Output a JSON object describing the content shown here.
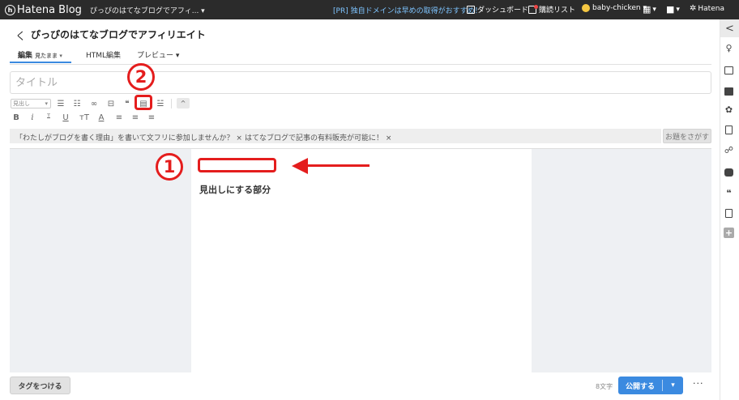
{
  "topbar": {
    "brand": "Hatena Blog",
    "brand_glyph": "h",
    "blog_select": "ぴっぴのはてなブログでアフィ... ▾",
    "pr_text": "[PR] 独自ドメインは早めの取得がおすすめ！",
    "dashboard": "ダッシュボード",
    "reading_list": "購読リスト",
    "user": "baby-chicken ▾",
    "grid_caret": "▾",
    "chat_caret": "▾",
    "hatena": "Hatena"
  },
  "header": {
    "back": "く",
    "blog_title": "ぴっぴのはてなブログでアフィリエイト"
  },
  "tabs": [
    {
      "label": "編集",
      "sub": "見たまま ▾"
    },
    {
      "label": "HTML編集"
    },
    {
      "label": "プレビュー ▾"
    }
  ],
  "title_input": {
    "placeholder": "タイトル"
  },
  "toolbar": {
    "heading_select": "見出し",
    "heading_caret": "▾",
    "row1": [
      "☰",
      "☷",
      "∞",
      "⊟",
      "❝",
      "▤",
      "☱"
    ],
    "row2": [
      "B",
      "i",
      "ᵀ",
      "U",
      "ᴛT",
      "A",
      "≡",
      "≡",
      "≡"
    ],
    "collapse": "^"
  },
  "annotations": {
    "one": "1",
    "two": "2"
  },
  "suggestions": {
    "items": [
      "「わたしがブログを書く理由」を書いて文フリに参加しませんか？ ×",
      "はてなブログで記事の有料販売が可能に！ ×"
    ],
    "search_button": "お題をさがす"
  },
  "editor": {
    "heading_text": "見出しにする部分"
  },
  "footer": {
    "tag_button": "タグをつける",
    "char_count": "8文字",
    "publish_button": "公開する",
    "publish_caret": "▾",
    "more": "···"
  },
  "sidebar": {
    "toggle": "<",
    "icons": [
      "lightbulb-icon",
      "photo-icon",
      "folder-icon",
      "gear-icon",
      "document-icon",
      "people-icon",
      "youtube-icon",
      "quote-icon",
      "clipboard-icon",
      "plus-icon"
    ],
    "plus": "+"
  },
  "colors": {
    "accent": "#3b8ae0",
    "annotation_red": "#e41d1d",
    "topbar": "#2b2b2b"
  }
}
